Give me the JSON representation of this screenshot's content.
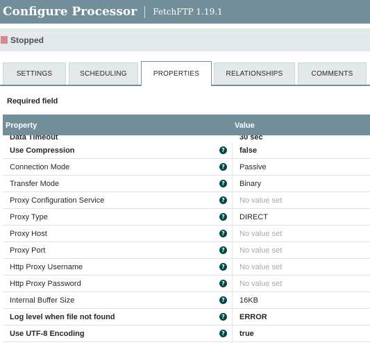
{
  "dialog": {
    "title": "Configure Processor",
    "subtitle": "FetchFTP 1.19.1"
  },
  "status": {
    "label": "Stopped",
    "color": "#d9888a"
  },
  "tabs": [
    {
      "label": "SETTINGS",
      "active": false
    },
    {
      "label": "SCHEDULING",
      "active": false
    },
    {
      "label": "PROPERTIES",
      "active": true
    },
    {
      "label": "RELATIONSHIPS",
      "active": false
    },
    {
      "label": "COMMENTS",
      "active": false
    }
  ],
  "required_label": "Required field",
  "grid": {
    "property_header": "Property",
    "value_header": "Value",
    "partial_row": {
      "name": "Data Timeout",
      "value": "30 sec"
    },
    "rows": [
      {
        "name": "Use Compression",
        "value": "false",
        "required": true,
        "empty": false
      },
      {
        "name": "Connection Mode",
        "value": "Passive",
        "required": false,
        "empty": false
      },
      {
        "name": "Transfer Mode",
        "value": "Binary",
        "required": false,
        "empty": false
      },
      {
        "name": "Proxy Configuration Service",
        "value": "No value set",
        "required": false,
        "empty": true
      },
      {
        "name": "Proxy Type",
        "value": "DIRECT",
        "required": false,
        "empty": false
      },
      {
        "name": "Proxy Host",
        "value": "No value set",
        "required": false,
        "empty": true
      },
      {
        "name": "Proxy Port",
        "value": "No value set",
        "required": false,
        "empty": true
      },
      {
        "name": "Http Proxy Username",
        "value": "No value set",
        "required": false,
        "empty": true
      },
      {
        "name": "Http Proxy Password",
        "value": "No value set",
        "required": false,
        "empty": true
      },
      {
        "name": "Internal Buffer Size",
        "value": "16KB",
        "required": false,
        "empty": false
      },
      {
        "name": "Log level when file not found",
        "value": "ERROR",
        "required": true,
        "empty": false
      },
      {
        "name": "Use UTF-8 Encoding",
        "value": "true",
        "required": true,
        "empty": false
      }
    ]
  },
  "icons": {
    "help": "help-icon",
    "help_glyph": "?"
  },
  "colors": {
    "header_bg": "#728e9b",
    "help_icon": "#004849",
    "empty_value": "#a8a8a8"
  }
}
